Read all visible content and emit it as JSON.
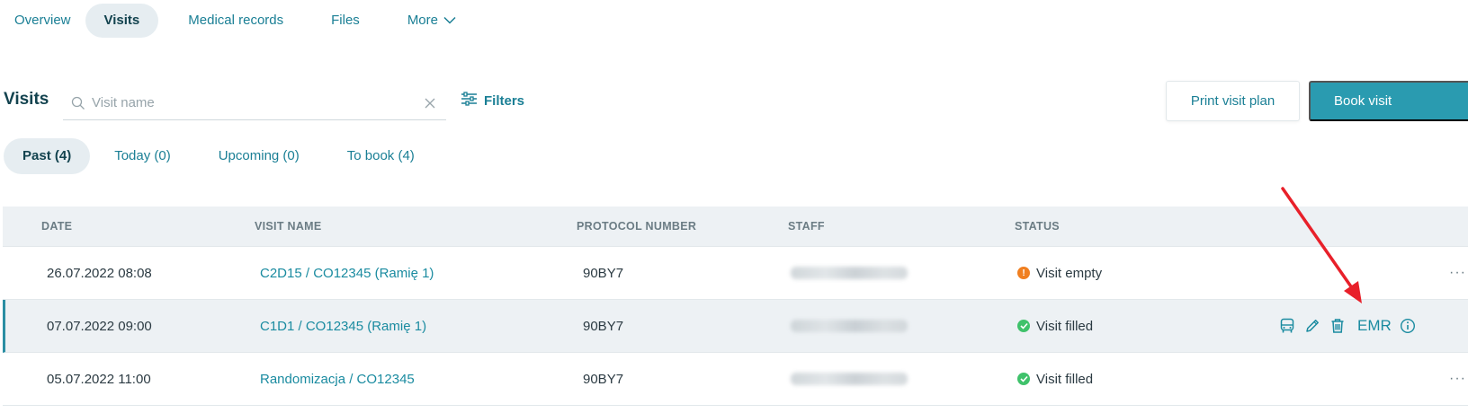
{
  "topnav": {
    "tabs": [
      {
        "label": "Overview"
      },
      {
        "label": "Visits"
      },
      {
        "label": "Medical records"
      },
      {
        "label": "Files"
      },
      {
        "label": "More"
      }
    ],
    "active_index": 1
  },
  "header": {
    "title": "Visits",
    "search_placeholder": "Visit name",
    "filters_label": "Filters",
    "print_label": "Print visit plan",
    "book_label": "Book visit"
  },
  "subtabs": {
    "items": [
      {
        "label": "Past (4)"
      },
      {
        "label": "Today (0)"
      },
      {
        "label": "Upcoming (0)"
      },
      {
        "label": "To book (4)"
      }
    ],
    "active_index": 0
  },
  "table": {
    "columns": [
      "DATE",
      "VISIT NAME",
      "PROTOCOL NUMBER",
      "STAFF",
      "STATUS"
    ],
    "rows": [
      {
        "date": "26.07.2022 08:08",
        "visit_name": "C2D15 / CO12345  (Ramię 1)",
        "protocol": "90BY7",
        "status": "Visit empty",
        "status_type": "empty"
      },
      {
        "date": "07.07.2022 09:00",
        "visit_name": "C1D1 / CO12345  (Ramię 1)",
        "protocol": "90BY7",
        "status": "Visit filled",
        "status_type": "filled"
      },
      {
        "date": "05.07.2022 11:00",
        "visit_name": "Randomizacja / CO12345",
        "protocol": "90BY7",
        "status": "Visit filled",
        "status_type": "filled"
      }
    ],
    "row_actions": {
      "emr_label": "EMR",
      "more_glyph": "···"
    }
  },
  "colors": {
    "accent": "#1a8ba0",
    "primary_button": "#2a9bb0",
    "status_empty": "#f07f20",
    "status_filled": "#3fc26b",
    "annotation_arrow": "#e8202a"
  },
  "icons": [
    "search-icon",
    "clear-icon",
    "filters-icon",
    "chevron-down-icon",
    "warning-icon",
    "check-circle-icon",
    "bus-icon",
    "pencil-icon",
    "trash-icon",
    "info-icon",
    "more-icon"
  ]
}
